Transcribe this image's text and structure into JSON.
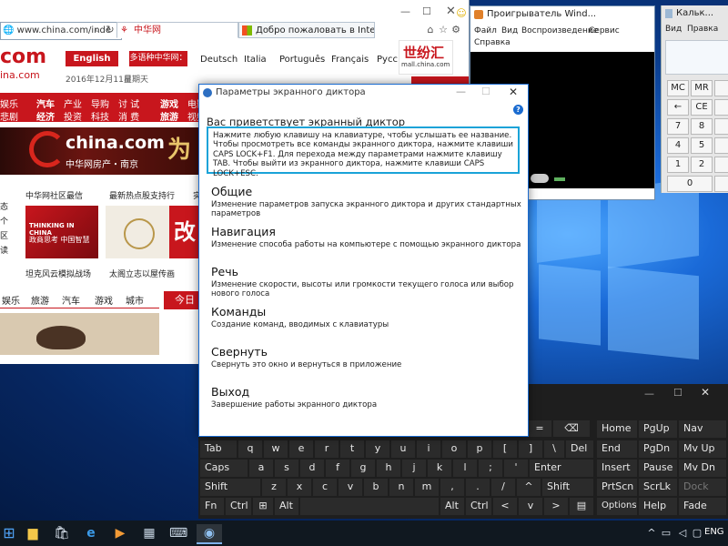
{
  "ie": {
    "address": "www.china.com/inde",
    "tabs": [
      {
        "label": "中华网"
      },
      {
        "label": "Добро пожаловать в Internet ..."
      }
    ],
    "site": {
      "logo_com": "com",
      "logo_sub": "ina.com",
      "english_btn": "English",
      "multilang_label": "多语种中华网：",
      "languages": [
        "Deutsch",
        "Italia",
        "Português",
        "Français",
        "Русс"
      ],
      "date": "2016年12月11日",
      "weekday": "星期天",
      "mall_brand": "世纷汇",
      "mall_url": "mall.china.com",
      "nav_rows": [
        [
          "娱乐",
          "汽车",
          "产业",
          "导购",
          "讨 试",
          "游戏",
          "电影"
        ],
        [
          "悲剧",
          "经济",
          "投资",
          "科技",
          "消 费",
          "旅游",
          "视频"
        ]
      ],
      "banner_brand": "china.com",
      "banner_tag": "中华网房产・南京",
      "left_links": [
        "态",
        "个",
        "区",
        "读"
      ],
      "news_row1": [
        "中华网社区最信",
        "最新热点股支持行",
        "实"
      ],
      "news_row2": [
        "坦克风云模拟战场",
        "太阁立志以屋传画"
      ],
      "ad_title": "THINKING IN CHINA",
      "ad_sub": "政商思考 中国智慧",
      "ad_badge": "改",
      "tabs_row": [
        "娱乐",
        "旅游",
        "汽车",
        "游戏",
        "城市"
      ],
      "today_btn": "今日"
    }
  },
  "wmp": {
    "title": "Проигрыватель Wind...",
    "menu": [
      "Файл",
      "Вид",
      "Воспроизведение",
      "Сервис",
      "Справка"
    ]
  },
  "calc": {
    "title": "Кальк...",
    "menu": [
      "Вид",
      "Правка"
    ],
    "keys": [
      [
        "MC",
        "MR"
      ],
      [
        "←",
        "CE"
      ],
      [
        "7",
        "8"
      ],
      [
        "4",
        "5"
      ],
      [
        "1",
        "2"
      ],
      [
        "0",
        ""
      ]
    ]
  },
  "narrator": {
    "title": "Параметры экранного диктора",
    "welcome": "Вас приветствует экранный диктор",
    "intro": "Нажмите любую клавишу на клавиатуре, чтобы услышать ее название. Чтобы просмотреть все команды экранного диктора, нажмите клавиши CAPS LOCK+F1. Для перехода между параметрами нажмите клавишу TAB. Чтобы выйти из экранного диктора, нажмите клавиши CAPS LOCK+ESC.",
    "sections": [
      {
        "title": "Общие",
        "desc": "Изменение параметров запуска экранного диктора и других стандартных параметров"
      },
      {
        "title": "Навигация",
        "desc": "Изменение способа работы на компьютере с помощью экранного диктора"
      },
      {
        "title": "Речь",
        "desc": "Изменение скорости, высоты или громкости текущего голоса или выбор нового голоса"
      },
      {
        "title": "Команды",
        "desc": "Создание команд, вводимых с клавиатуры"
      },
      {
        "title": "Свернуть",
        "desc": "Свернуть это окно и вернуться в приложение"
      },
      {
        "title": "Выход",
        "desc": "Завершение работы экранного диктора"
      }
    ]
  },
  "osk": {
    "rows": {
      "r1_right": [
        "=",
        "⌫"
      ],
      "r2": [
        "Tab",
        "q",
        "w",
        "e",
        "r",
        "t",
        "y",
        "u",
        "i",
        "o",
        "p",
        "[",
        "]",
        "\\",
        "Del"
      ],
      "r3": [
        "Caps",
        "a",
        "s",
        "d",
        "f",
        "g",
        "h",
        "j",
        "k",
        "l",
        ";",
        "'",
        "Enter"
      ],
      "r4": [
        "Shift",
        "z",
        "x",
        "c",
        "v",
        "b",
        "n",
        "m",
        ",",
        ".",
        "/",
        "^",
        "Shift"
      ],
      "r5": [
        "Fn",
        "Ctrl",
        "⊞",
        "Alt",
        "Alt",
        "Ctrl",
        "<",
        "v",
        ">",
        "▤"
      ]
    },
    "nav": [
      [
        "Home",
        "PgUp",
        "Nav"
      ],
      [
        "End",
        "PgDn",
        "Mv Up"
      ],
      [
        "Insert",
        "Pause",
        "Mv Dn"
      ],
      [
        "PrtScn",
        "ScrLk",
        "Dock"
      ],
      [
        "Options",
        "Help",
        "Fade"
      ]
    ]
  },
  "taskbar": {
    "lang": "ENG"
  }
}
